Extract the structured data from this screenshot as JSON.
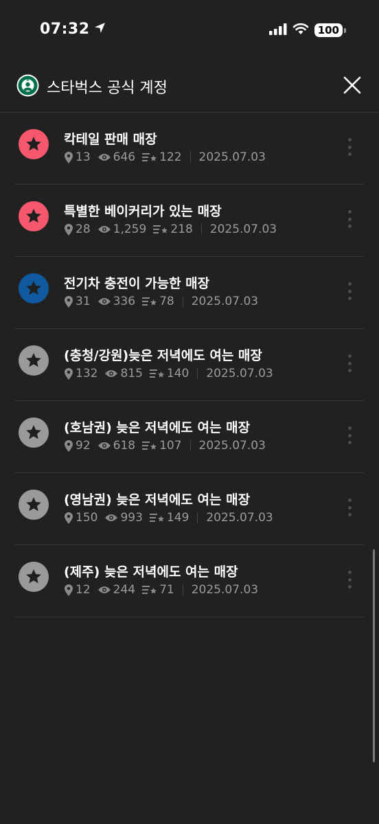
{
  "status_bar": {
    "time": "07:32",
    "battery": "100"
  },
  "header": {
    "title": "스타벅스 공식 계정"
  },
  "colors": {
    "background": "#212121",
    "pink": "#f5586d",
    "blue": "#0f5a9e",
    "gray": "#9a9a9a",
    "star": "#1f1f1f",
    "starbucks_green": "#00704a"
  },
  "lists": [
    {
      "title": "칵테일 판매 매장",
      "places": "13",
      "views": "646",
      "saves": "122",
      "date": "2025.07.03",
      "badge_color": "#f5586d"
    },
    {
      "title": "특별한 베이커리가 있는 매장",
      "places": "28",
      "views": "1,259",
      "saves": "218",
      "date": "2025.07.03",
      "badge_color": "#f5586d"
    },
    {
      "title": "전기차 충전이 가능한 매장",
      "places": "31",
      "views": "336",
      "saves": "78",
      "date": "2025.07.03",
      "badge_color": "#0f5a9e"
    },
    {
      "title": "(충청/강원)늦은 저녁에도 여는 매장",
      "places": "132",
      "views": "815",
      "saves": "140",
      "date": "2025.07.03",
      "badge_color": "#9a9a9a"
    },
    {
      "title": "(호남권) 늦은 저녁에도 여는 매장",
      "places": "92",
      "views": "618",
      "saves": "107",
      "date": "2025.07.03",
      "badge_color": "#9a9a9a"
    },
    {
      "title": "(영남권) 늦은 저녁에도 여는 매장",
      "places": "150",
      "views": "993",
      "saves": "149",
      "date": "2025.07.03",
      "badge_color": "#9a9a9a"
    },
    {
      "title": "(제주) 늦은 저녁에도 여는 매장",
      "places": "12",
      "views": "244",
      "saves": "71",
      "date": "2025.07.03",
      "badge_color": "#9a9a9a"
    }
  ]
}
